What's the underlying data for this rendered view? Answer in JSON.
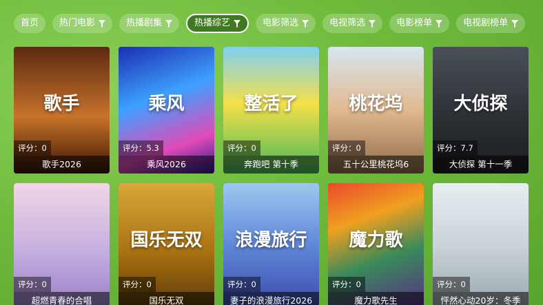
{
  "tabs": [
    {
      "label": "首页",
      "filter": false,
      "active": false
    },
    {
      "label": "热门电影",
      "filter": true,
      "active": false
    },
    {
      "label": "热播剧集",
      "filter": true,
      "active": false
    },
    {
      "label": "热播综艺",
      "filter": true,
      "active": true
    },
    {
      "label": "电影筛选",
      "filter": true,
      "active": false
    },
    {
      "label": "电视筛选",
      "filter": true,
      "active": false
    },
    {
      "label": "电影榜单",
      "filter": true,
      "active": false
    },
    {
      "label": "电视剧榜单",
      "filter": true,
      "active": false
    }
  ],
  "cards": [
    {
      "title": "歌手2026",
      "score": "评分：0",
      "poster_text": "歌手",
      "bg": "linear-gradient(180deg,#5a2a10 0%,#c9732a 55%,#3a1505 100%)"
    },
    {
      "title": "乘风2026",
      "score": "评分：5.3",
      "poster_text": "乘风",
      "bg": "linear-gradient(160deg,#1a2fb0 0%,#3da0ff 40%,#e24ab8 75%,#2a1a90 100%)"
    },
    {
      "title": "奔跑吧 第十季",
      "score": "评分：0",
      "poster_text": "整活了",
      "bg": "linear-gradient(180deg,#7fd0f0 0%,#f5e04a 45%,#46b85a 100%)"
    },
    {
      "title": "五十公里桃花坞6",
      "score": "评分：0",
      "poster_text": "桃花坞",
      "bg": "linear-gradient(180deg,#d7e6f0 0%,#e2b98f 50%,#8d6b4a 100%)"
    },
    {
      "title": "大侦探 第十一季",
      "score": "评分：7.7",
      "poster_text": "大侦探",
      "bg": "linear-gradient(180deg,#4a5058 0%,#2a2e33 60%,#1a1c1f 100%)"
    },
    {
      "title": "超燃青春的合唱",
      "score": "评分：0",
      "poster_text": "",
      "bg": "linear-gradient(180deg,#f2d6e6 0%,#c8b2e0 50%,#9a7fc9 100%)"
    },
    {
      "title": "国乐无双",
      "score": "评分：0",
      "poster_text": "国乐无双",
      "bg": "linear-gradient(180deg,#d9a83a 0%,#a87012 55%,#5a3a08 100%)"
    },
    {
      "title": "妻子的浪漫旅行2026",
      "score": "评分：0",
      "poster_text": "浪漫旅行",
      "bg": "linear-gradient(180deg,#9ec8f0 0%,#5f86d8 50%,#3a4aa8 100%)"
    },
    {
      "title": "魔力歌先生",
      "score": "评分：0",
      "poster_text": "魔力歌",
      "bg": "linear-gradient(160deg,#e84a2a 0%,#f0a020 30%,#3a8a5a 60%,#5a2a8a 100%)"
    },
    {
      "title": "怦然心动20岁：冬季",
      "score": "评分：0",
      "poster_text": "",
      "bg": "linear-gradient(180deg,#e8eef2 0%,#c9d2d8 50%,#9aa6ad 100%)"
    }
  ]
}
